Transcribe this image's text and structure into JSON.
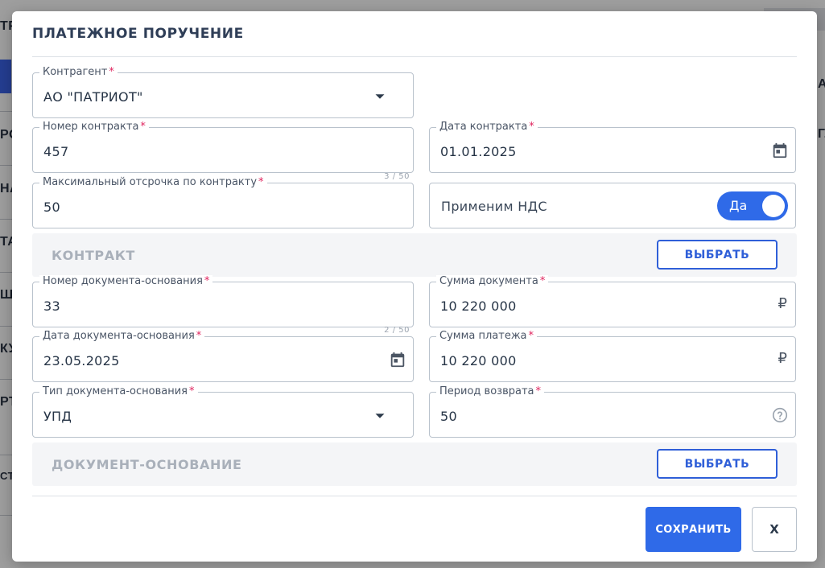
{
  "background": {
    "fragments": [
      "ТР",
      "РО",
      "НА",
      "ТА",
      "Ш",
      "КУ",
      "РТ",
      "СТ"
    ],
    "right_fragments": [
      "А",
      "ГЛ"
    ]
  },
  "modal": {
    "title": "ПЛАТЕЖНОЕ ПОРУЧЕНИЕ",
    "fields": {
      "counterparty": {
        "label": "Контрагент",
        "value": "АО \"ПАТРИОТ\"",
        "icon": "chevron-down-icon"
      },
      "contract_number": {
        "label": "Номер контракта",
        "value": "457"
      },
      "contract_date": {
        "label": "Дата контракта",
        "value": "01.01.2025",
        "icon": "calendar-icon"
      },
      "max_deferral": {
        "label": "Максимальный отсрочка по контракту",
        "value": "50",
        "counter": "3 / 50"
      },
      "vat": {
        "label": "Применим НДС",
        "toggle_text": "Да",
        "on": true
      },
      "doc_number": {
        "label": "Номер документа-основания",
        "value": "33"
      },
      "doc_amount": {
        "label": "Сумма документа",
        "value": "10 220 000",
        "currency": "₽"
      },
      "doc_date": {
        "label": "Дата документа-основания",
        "value": "23.05.2025",
        "counter": "2 / 50",
        "icon": "calendar-icon"
      },
      "payment_amount": {
        "label": "Сумма платежа",
        "value": "10 220 000",
        "currency": "₽"
      },
      "doc_type": {
        "label": "Тип документа-основания",
        "value": "УПД",
        "icon": "chevron-down-icon"
      },
      "return_period": {
        "label": "Период возврата",
        "value": "50",
        "icon": "help-circle-icon"
      }
    },
    "required_mark": "*",
    "sections": {
      "contract": {
        "label": "КОНТРАКТ",
        "button": "ВЫБРАТЬ"
      },
      "base_document": {
        "label": "ДОКУМЕНТ-ОСНОВАНИЕ",
        "button": "ВЫБРАТЬ"
      }
    },
    "footer": {
      "save": "СОХРАНИТЬ",
      "close": "X"
    }
  },
  "colors": {
    "primary": "#2f6ae8",
    "required": "#e0245e",
    "section_label": "#a9b0ba"
  }
}
